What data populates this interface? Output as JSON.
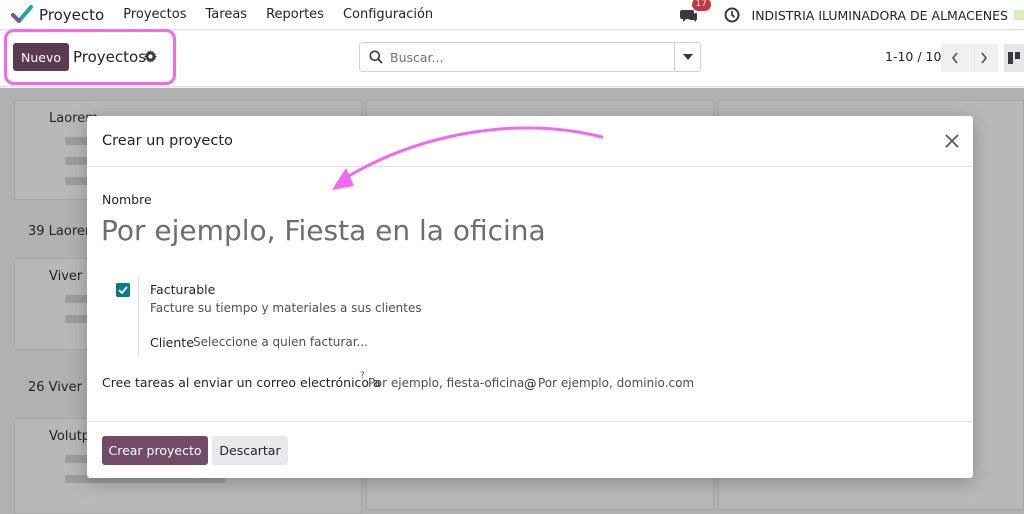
{
  "navbar": {
    "app_name": "Proyecto",
    "menu": [
      "Proyectos",
      "Tareas",
      "Reportes",
      "Configuración"
    ],
    "chat_badge": "17",
    "company": "INDISTRIA ILUMINADORA DE ALMACENES"
  },
  "control_panel": {
    "new_button": "Nuevo",
    "breadcrumb": "Proyectos",
    "search_placeholder": "Buscar...",
    "pager": "1-10 / 10"
  },
  "background": {
    "columns": [
      {
        "cards": [
          {
            "title": "Laorem",
            "count_title": "39 Laorem"
          },
          {
            "title": "Viver",
            "count_title": "26 Viver"
          },
          {
            "title": "Volutp"
          }
        ]
      }
    ]
  },
  "modal": {
    "title": "Crear un proyecto",
    "name_label": "Nombre",
    "name_placeholder": "Por ejemplo, Fiesta en la oficina",
    "billable": {
      "checked": true,
      "title": "Facturable",
      "description": "Facture su tiempo y materiales a sus clientes"
    },
    "client_label": "Cliente",
    "client_placeholder": "Seleccione a quien facturar...",
    "alias_label": "Cree tareas al enviar un correo electrónico a",
    "alias_help": "?",
    "alias_placeholder": "Por ejemplo, fiesta-oficina",
    "alias_at": "@",
    "domain_placeholder": "Por ejemplo, dominio.com",
    "create_button": "Crear proyecto",
    "discard_button": "Descartar"
  },
  "colors": {
    "primary": "#714b67",
    "accent": "#017e84",
    "highlight": "#f268f2"
  }
}
